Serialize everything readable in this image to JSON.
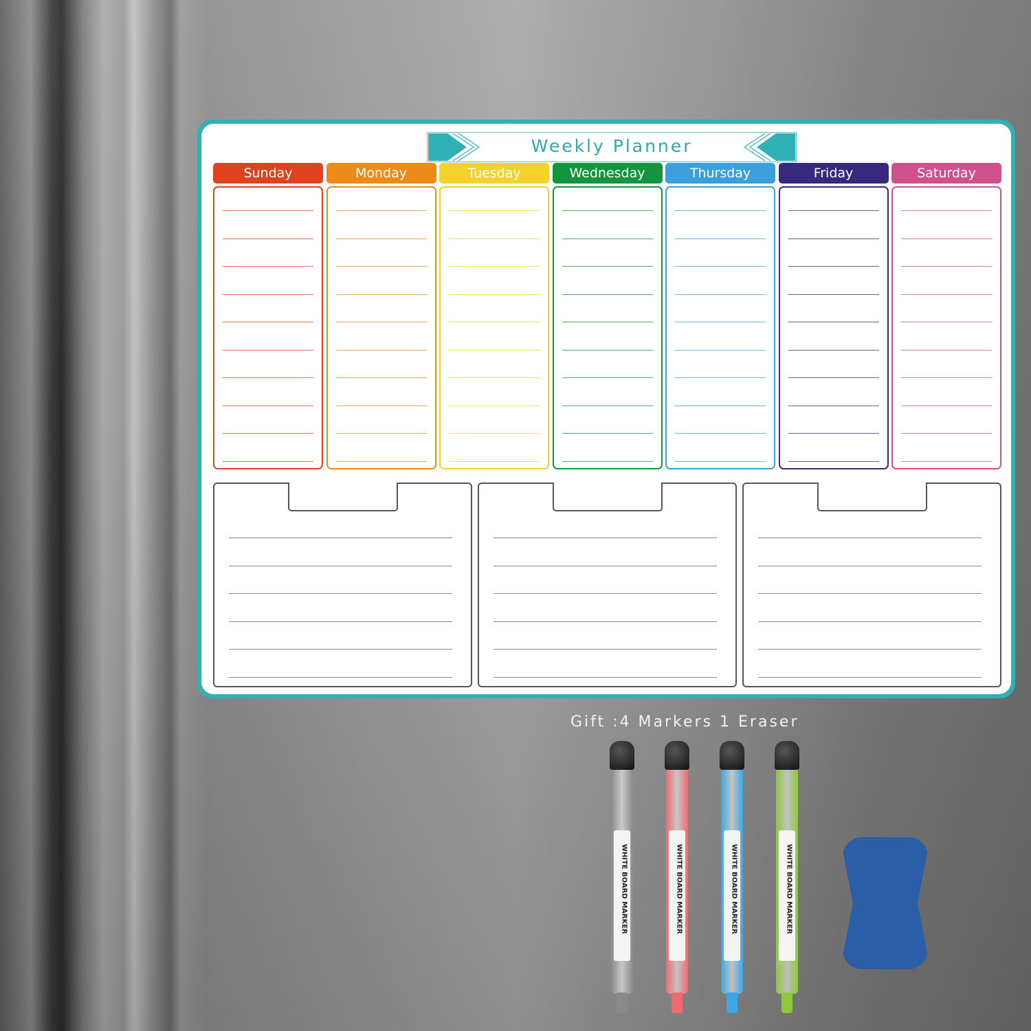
{
  "planner": {
    "title": "Weekly Planner",
    "accent_color": "#2fb1b5",
    "days": [
      {
        "label": "Sunday",
        "color": "#e2411f"
      },
      {
        "label": "Monday",
        "color": "#ec8a1a"
      },
      {
        "label": "Tuesday",
        "color": "#f5d22a"
      },
      {
        "label": "Wednesday",
        "color": "#13943e"
      },
      {
        "label": "Thursday",
        "color": "#3a9fdb"
      },
      {
        "label": "Friday",
        "color": "#372a7e"
      },
      {
        "label": "Saturday",
        "color": "#d0508e"
      }
    ],
    "lines_per_day": 10,
    "note_boxes": 3,
    "lines_per_note": 6
  },
  "gift": {
    "caption": "Gift :4 Markers 1 Eraser",
    "markers": [
      {
        "color": "#8a8a8a",
        "label": "WHITE BOARD MARKER"
      },
      {
        "color": "#f06a72",
        "label": "WHITE BOARD MARKER"
      },
      {
        "color": "#3aa8e6",
        "label": "WHITE BOARD MARKER"
      },
      {
        "color": "#8fc93a",
        "label": "WHITE BOARD MARKER"
      }
    ],
    "eraser_color": "#2a5fa8"
  }
}
